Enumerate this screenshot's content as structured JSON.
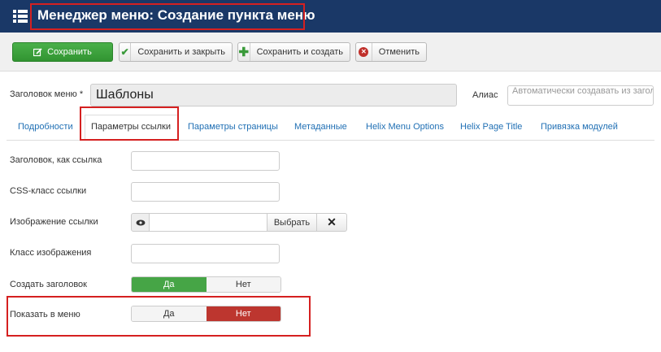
{
  "header": {
    "title": "Менеджер меню: Создание пункта меню",
    "icon": "list-icon",
    "background": "#1a3867"
  },
  "toolbar": {
    "save_label": "Сохранить",
    "save_close_label": "Сохранить и закрыть",
    "save_new_label": "Сохранить и создать",
    "cancel_label": "Отменить",
    "save_icon": "edit-icon",
    "save_close_icon": "check-icon",
    "save_new_icon": "plus-icon",
    "cancel_icon": "cancel-icon"
  },
  "title_row": {
    "menu_title_label": "Заголовок меню *",
    "menu_title_value": "Шаблоны",
    "alias_label": "Алиас",
    "alias_placeholder": "Автоматически создавать из заголовка"
  },
  "tabs": [
    {
      "label": "Подробности",
      "active": false
    },
    {
      "label": "Параметры ссылки",
      "active": true
    },
    {
      "label": "Параметры страницы",
      "active": false
    },
    {
      "label": "Метаданные",
      "active": false
    },
    {
      "label": "Helix Menu Options",
      "active": false
    },
    {
      "label": "Helix Page Title",
      "active": false
    },
    {
      "label": "Привязка модулей",
      "active": false
    }
  ],
  "form": {
    "link_title_label": "Заголовок, как ссылка",
    "link_css_label": "CSS-класс ссылки",
    "link_image_label": "Изображение ссылки",
    "image_select_label": "Выбрать",
    "image_class_label": "Класс изображения",
    "create_heading_label": "Создать заголовок",
    "create_heading_yes": "Да",
    "create_heading_no": "Нет",
    "create_heading_value": "Да",
    "show_in_menu_label": "Показать в меню",
    "show_in_menu_yes": "Да",
    "show_in_menu_no": "Нет",
    "show_in_menu_value": "Нет"
  },
  "colors": {
    "highlight": "#d52020",
    "save_green": "#46a546",
    "no_red": "#bd362f",
    "link_blue": "#1f6fb4"
  }
}
